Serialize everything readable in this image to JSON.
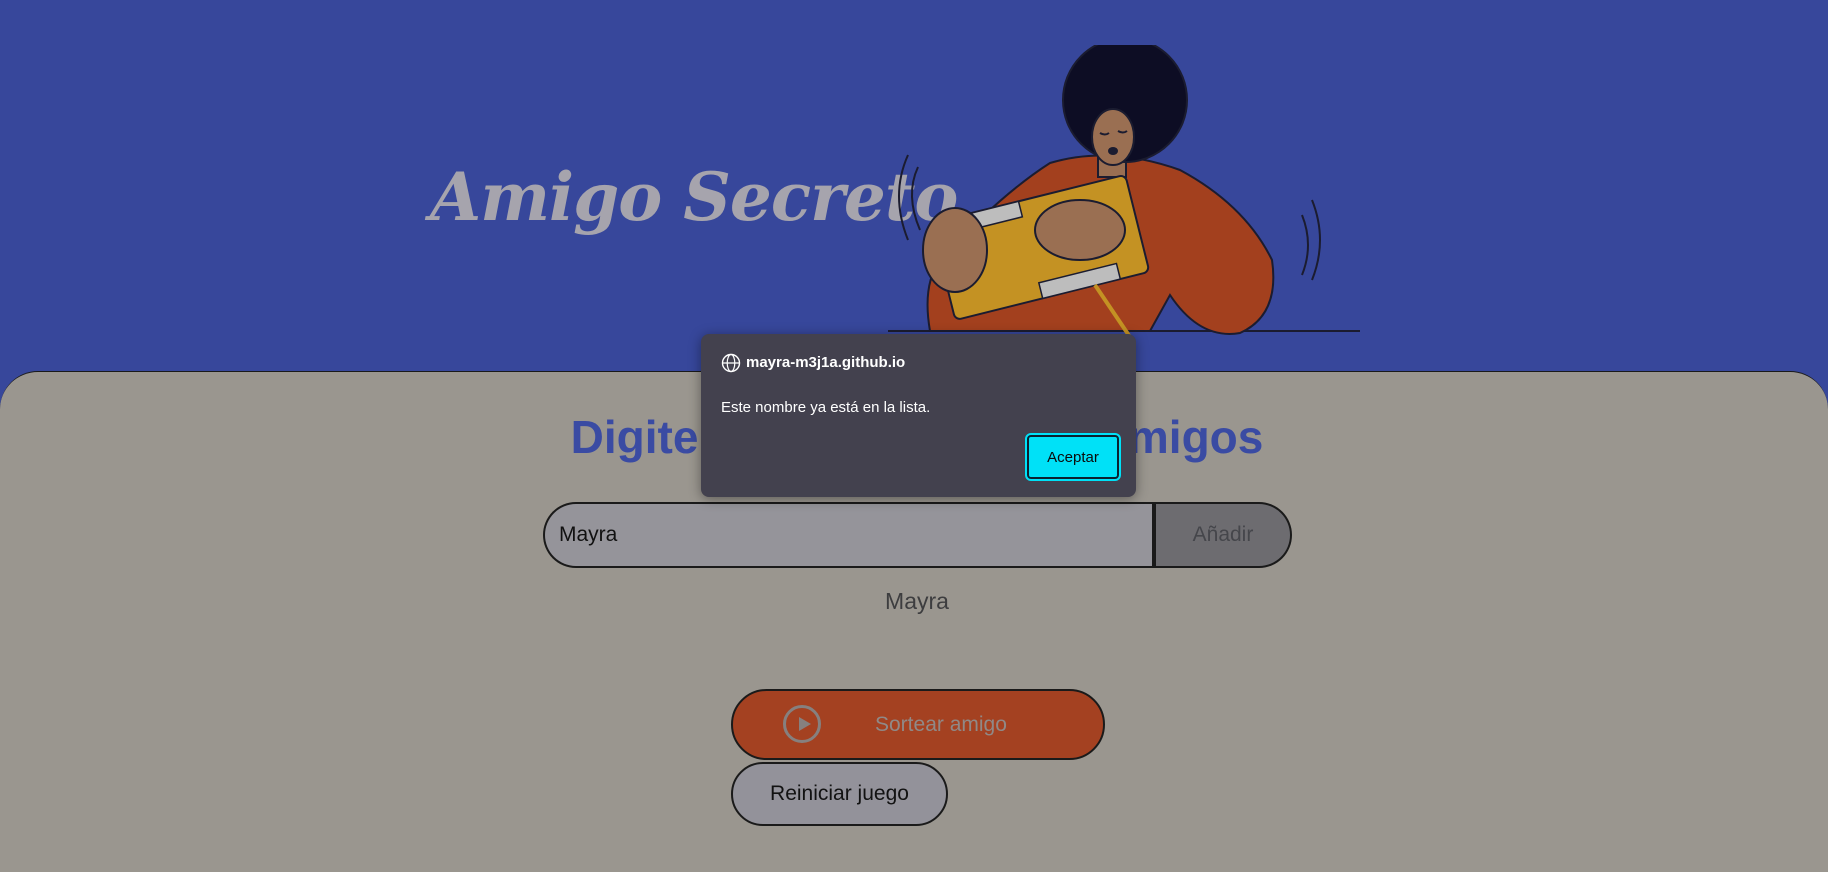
{
  "header": {
    "title": "Amigo Secreto"
  },
  "main": {
    "section_title": "Digite el nombre de sus amigos",
    "input": {
      "value": "Mayra"
    },
    "add_label": "Añadir",
    "friends": [
      "Mayra"
    ],
    "draw_label": "Sortear amigo",
    "reset_label": "Reiniciar juego"
  },
  "dialog": {
    "origin": "mayra-m3j1a.github.io",
    "message": "Este nombre ya está en la lista.",
    "ok_label": "Aceptar"
  },
  "icons": {
    "play": "play-icon",
    "globe": "globe-icon"
  },
  "colors": {
    "header_bg": "#37479b",
    "main_bg": "#9a968f",
    "section_title": "#3a4ba3",
    "draw_button": "#a44121",
    "dialog_bg": "#43414e",
    "dialog_button": "#00e1f7"
  }
}
